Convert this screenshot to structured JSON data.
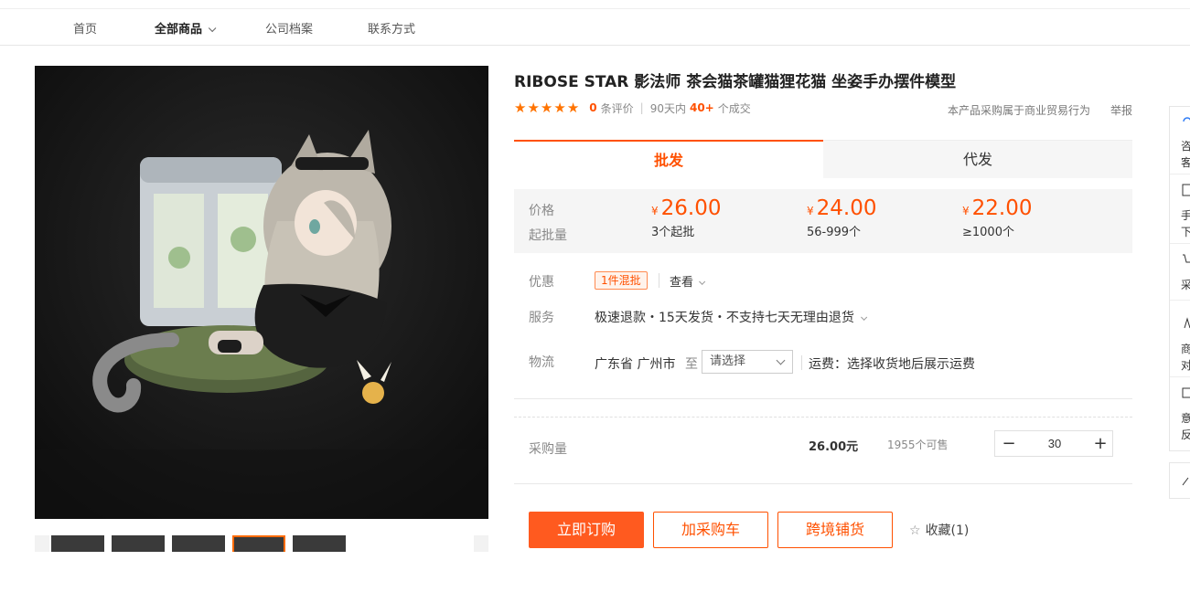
{
  "nav": {
    "items": [
      "首页",
      "全部商品",
      "公司档案",
      "联系方式"
    ]
  },
  "product": {
    "title": "RIBOSE STAR 影法师 茶会猫茶罐猫狸花猫 坐姿手办摆件模型",
    "rating_count": "0",
    "rating_label": "条评价",
    "days_label": "90天内",
    "deals": "40+",
    "deals_label": "个成交",
    "notice": "本产品采购属于商业贸易行为",
    "report": "举报"
  },
  "tabs": {
    "wholesale": "批发",
    "dropship": "代发"
  },
  "pricing": {
    "price_label": "价格",
    "moq_label": "起批量",
    "currency": "¥",
    "tiers": [
      {
        "price": "26.00",
        "moq": "3个起批"
      },
      {
        "price": "24.00",
        "moq": "56-999个"
      },
      {
        "price": "22.00",
        "moq": "≥1000个"
      }
    ]
  },
  "promo": {
    "label": "优惠",
    "tag": "1件混批",
    "view": "查看"
  },
  "service": {
    "label": "服务",
    "text": "极速退款・15天发货・不支持七天无理由退货"
  },
  "logistics": {
    "label": "物流",
    "origin": "广东省 广州市",
    "to": "至",
    "select_placeholder": "请选择",
    "freight": "运费：选择收货地后展示运费"
  },
  "quantity": {
    "label": "采购量",
    "price": "26.00元",
    "stock": "1955个可售",
    "value": "30",
    "minus": "−",
    "plus": "+"
  },
  "actions": {
    "order": "立即订购",
    "cart": "加采购车",
    "cross_border": "跨境铺货",
    "favorite": "收藏(1)"
  },
  "sidebar": {
    "items": [
      {
        "l1": "咨",
        "l2": "客"
      },
      {
        "l1": "手",
        "l2": "下"
      },
      {
        "l1": "采",
        "l2": ""
      },
      {
        "l1": "商",
        "l2": "对"
      },
      {
        "l1": "意",
        "l2": "反"
      }
    ]
  },
  "colors": {
    "accent": "#ff5000",
    "primary_button": "#ff5a1f",
    "price_bg": "#f5f5f5"
  }
}
